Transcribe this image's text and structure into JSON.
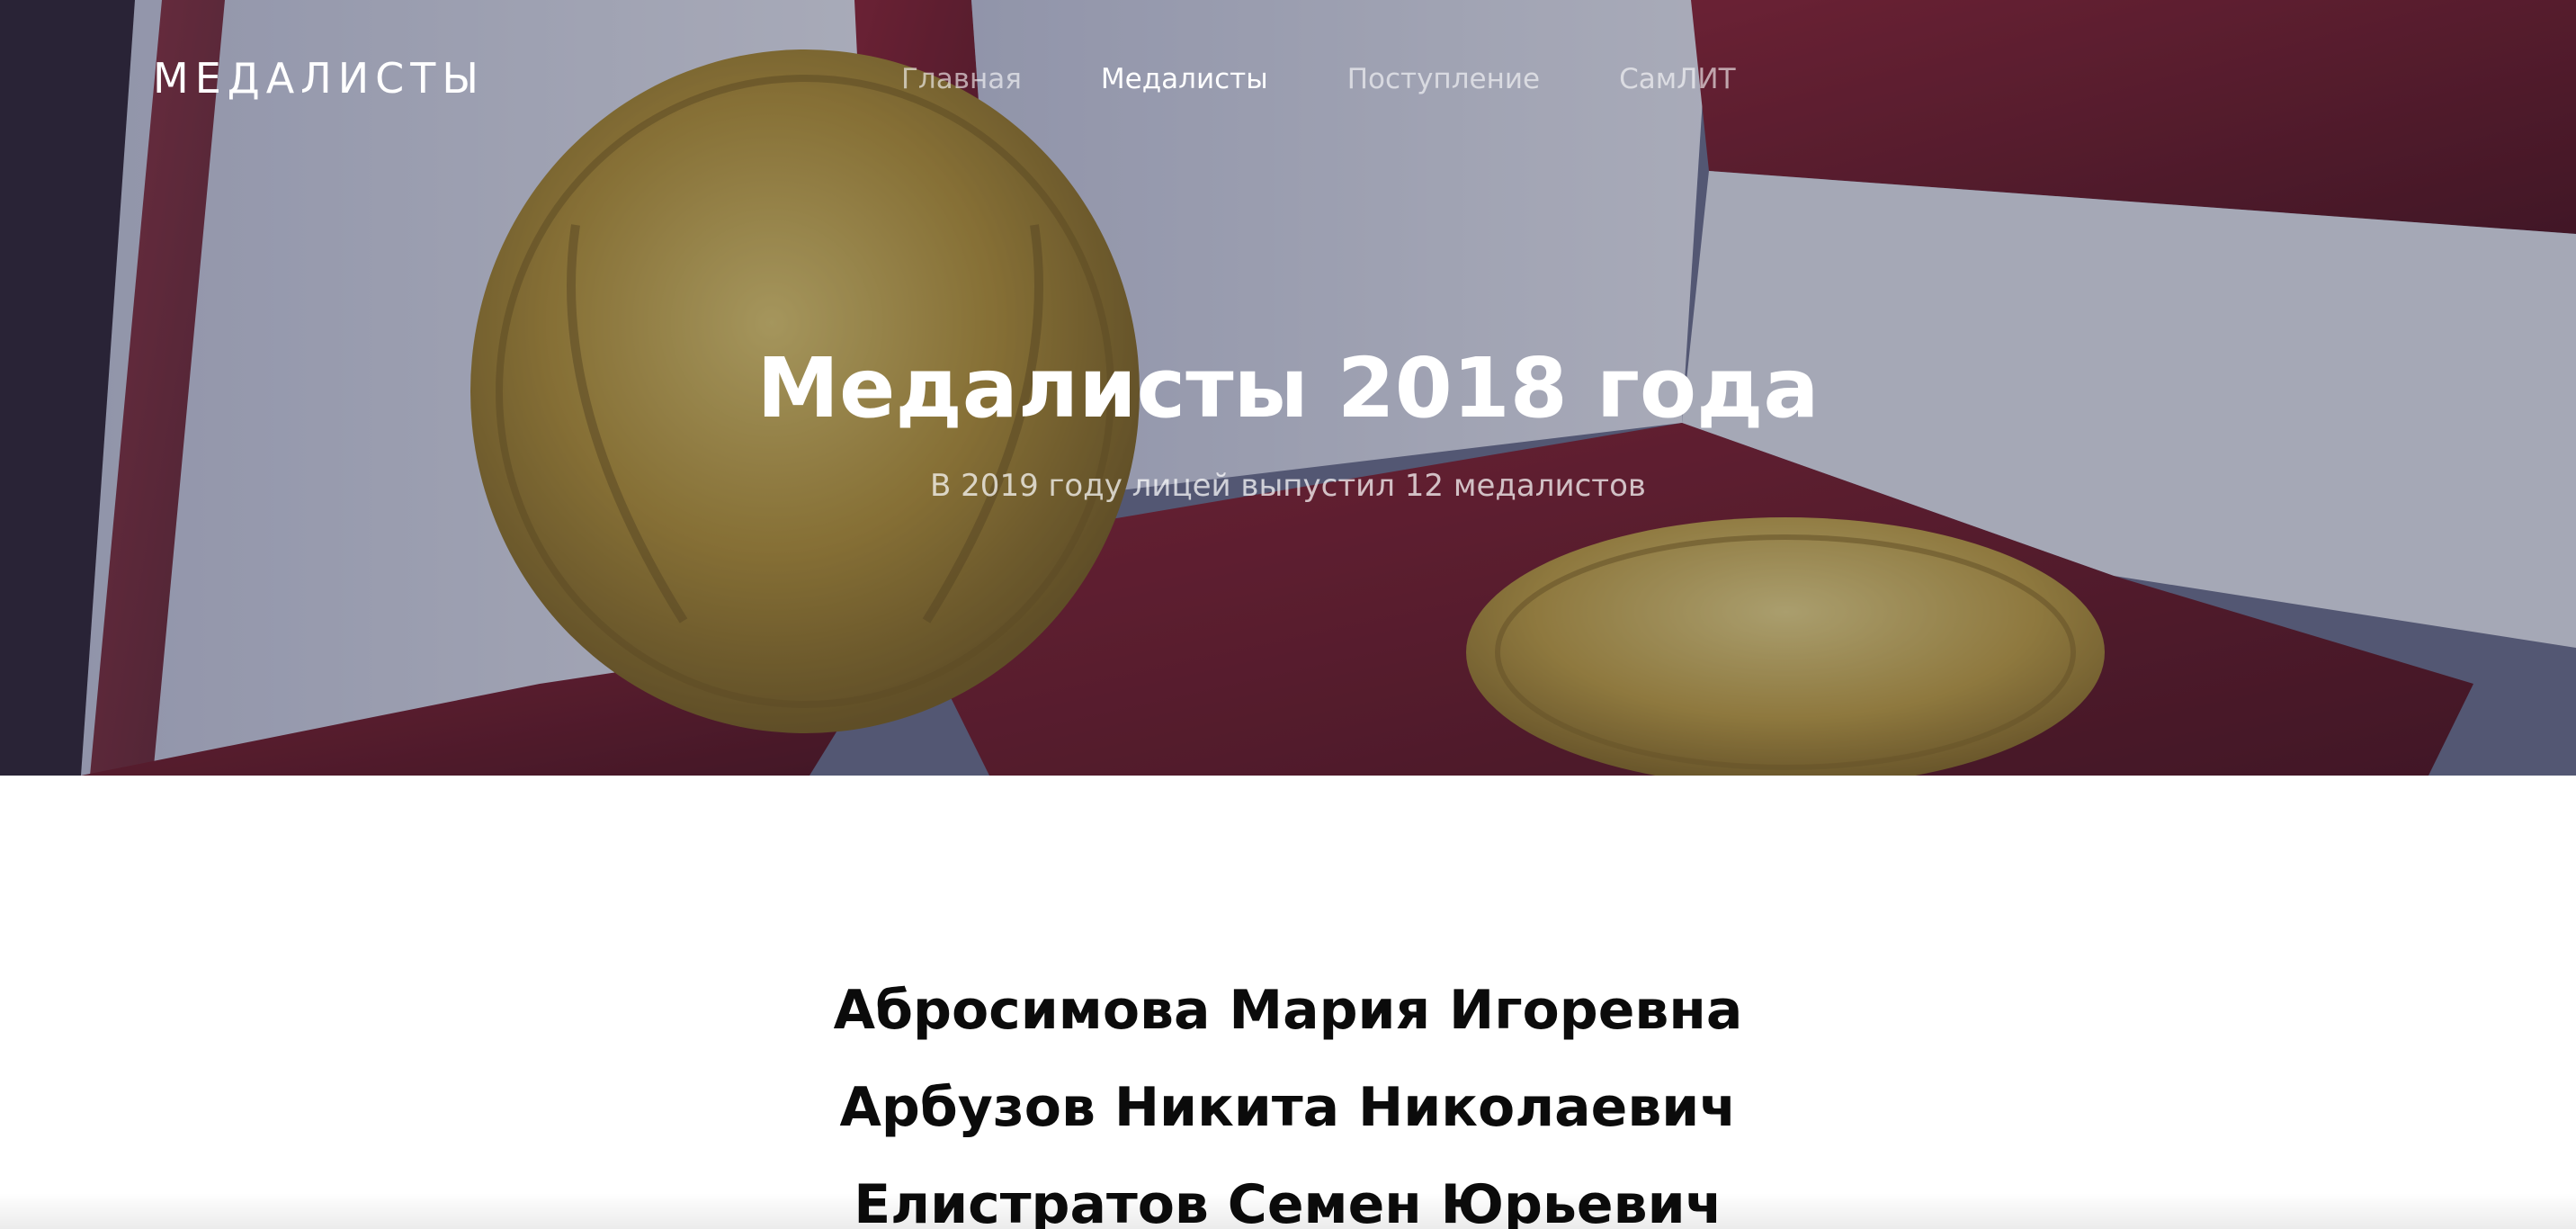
{
  "navbar": {
    "brand": "МЕДАЛИСТЫ",
    "links": [
      {
        "label": "Главная",
        "active": false
      },
      {
        "label": "Медалисты",
        "active": true
      },
      {
        "label": "Поступление",
        "active": false
      },
      {
        "label": "СамЛИТ",
        "active": false
      }
    ]
  },
  "hero": {
    "title": "Медалисты 2018 года",
    "subtitle": "В 2019 году лицей выпустил 12 медалистов"
  },
  "medalists": [
    "Абросимова Мария Игоревна",
    "Арбузов Никита Николаевич",
    "Елистратов Семен Юрьевич"
  ],
  "colors": {
    "text_dark": "#0b0b0b",
    "nav_active": "#ffffff",
    "nav_inactive": "rgba(255,255,255,0.6)",
    "medal_gold": "#c9a43a",
    "case_velvet": "#7a1522"
  }
}
